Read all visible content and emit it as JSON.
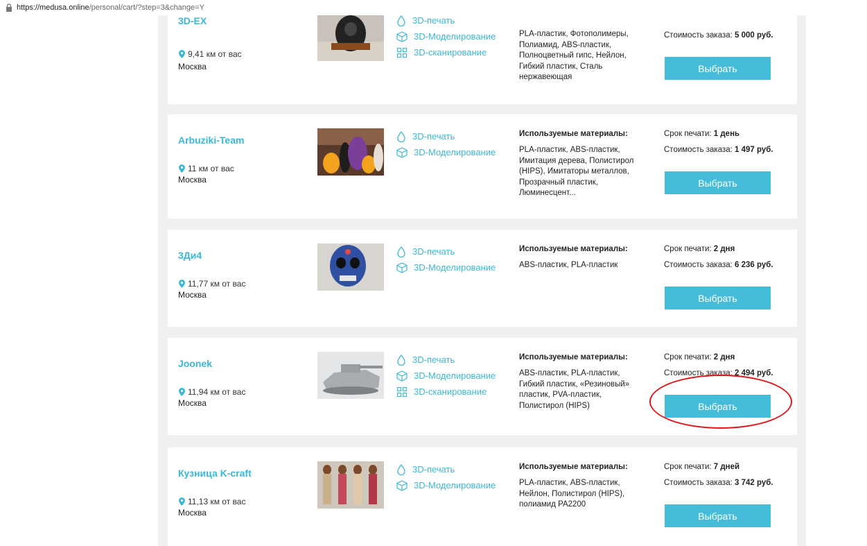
{
  "browser": {
    "url_host": "https://medusa.online",
    "url_path": "/personal/cart/?step=3&change=Y"
  },
  "labels": {
    "materials_title": "Используемые материалы:",
    "term_prefix": "Срок печати: ",
    "cost_prefix": "Стоимость заказа: ",
    "select_button": "Выбрать"
  },
  "colors": {
    "accent": "#45bcd9",
    "link": "#3ab8d9",
    "highlight": "#e0161b"
  },
  "providers": [
    {
      "name": "3D-EX",
      "distance": "9,41 км от вас",
      "city": "Москва",
      "services": [
        {
          "icon": "drop-icon",
          "label": "3D-печать"
        },
        {
          "icon": "cube-icon",
          "label": "3D-Моделирование"
        },
        {
          "icon": "scan-icon",
          "label": "3D-сканирование"
        }
      ],
      "materials_title": "",
      "materials": "PLA-пластик, Фотополимеры, Полиамид, ABS-пластик, Полноцветный гипс, Нейлон, Гибкий пластик, Сталь нержавеющая",
      "term": "",
      "cost": "5 000 руб."
    },
    {
      "name": "Arbuziki-Team",
      "distance": "11 км от вас",
      "city": "Москва",
      "services": [
        {
          "icon": "drop-icon",
          "label": "3D-печать"
        },
        {
          "icon": "cube-icon",
          "label": "3D-Моделирование"
        }
      ],
      "materials_title": "Используемые материалы:",
      "materials": "PLA-пластик, ABS-пластик, Имитация дерева, Полистирол (HIPS), Имитаторы металлов, Прозрачный пластик, Люминесцент...",
      "term": "1 день",
      "cost": "1 497 руб."
    },
    {
      "name": "3Ди4",
      "distance": "11,77 км от вас",
      "city": "Москва",
      "services": [
        {
          "icon": "drop-icon",
          "label": "3D-печать"
        },
        {
          "icon": "cube-icon",
          "label": "3D-Моделирование"
        }
      ],
      "materials_title": "Используемые материалы:",
      "materials": "ABS-пластик, PLA-пластик",
      "term": "2 дня",
      "cost": "6 236 руб."
    },
    {
      "name": "Joonek",
      "distance": "11,94 км от вас",
      "city": "Москва",
      "services": [
        {
          "icon": "drop-icon",
          "label": "3D-печать"
        },
        {
          "icon": "cube-icon",
          "label": "3D-Моделирование"
        },
        {
          "icon": "scan-icon",
          "label": "3D-сканирование"
        }
      ],
      "materials_title": "Используемые материалы:",
      "materials": "ABS-пластик, PLA-пластик, Гибкий пластик, «Резиновый» пластик, PVA-пластик, Полистирол (HIPS)",
      "term": "2 дня",
      "cost": "2 494 руб."
    },
    {
      "name": "Кузница K-craft",
      "distance": "11,13 км от вас",
      "city": "Москва",
      "services": [
        {
          "icon": "drop-icon",
          "label": "3D-печать"
        },
        {
          "icon": "cube-icon",
          "label": "3D-Моделирование"
        }
      ],
      "materials_title": "Используемые материалы:",
      "materials": "PLA-пластик, ABS-пластик, Нейлон, Полистирол (HIPS), полиамид PA2200",
      "term": "7 дней",
      "cost": "3 742 руб."
    }
  ]
}
